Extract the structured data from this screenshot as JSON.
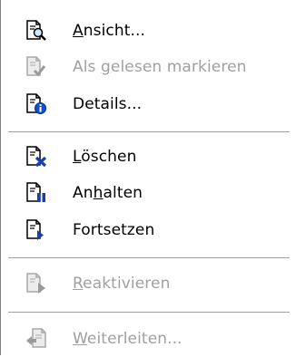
{
  "menu": {
    "items": [
      {
        "label_pre": "",
        "label_ul": "A",
        "label_post": "nsicht...",
        "disabled": false,
        "icon": "page-magnifier-icon"
      },
      {
        "label_pre": "Als ",
        "label_ul": "g",
        "label_post": "elesen markieren",
        "disabled": true,
        "icon": "page-check-icon"
      },
      {
        "label_pre": "Details...",
        "label_ul": "",
        "label_post": "",
        "disabled": false,
        "icon": "page-info-icon"
      },
      {
        "label_pre": "",
        "label_ul": "L",
        "label_post": "öschen",
        "disabled": false,
        "icon": "page-delete-icon"
      },
      {
        "label_pre": "An",
        "label_ul": "h",
        "label_post": "alten",
        "disabled": false,
        "icon": "page-pause-icon"
      },
      {
        "label_pre": "Fortsetzen",
        "label_ul": "",
        "label_post": "",
        "disabled": false,
        "icon": "page-resume-icon"
      },
      {
        "label_pre": "",
        "label_ul": "R",
        "label_post": "eaktivieren",
        "disabled": true,
        "icon": "page-reactivate-icon"
      },
      {
        "label_pre": "",
        "label_ul": "W",
        "label_post": "eiterleiten...",
        "disabled": true,
        "icon": "page-forward-icon"
      }
    ]
  }
}
